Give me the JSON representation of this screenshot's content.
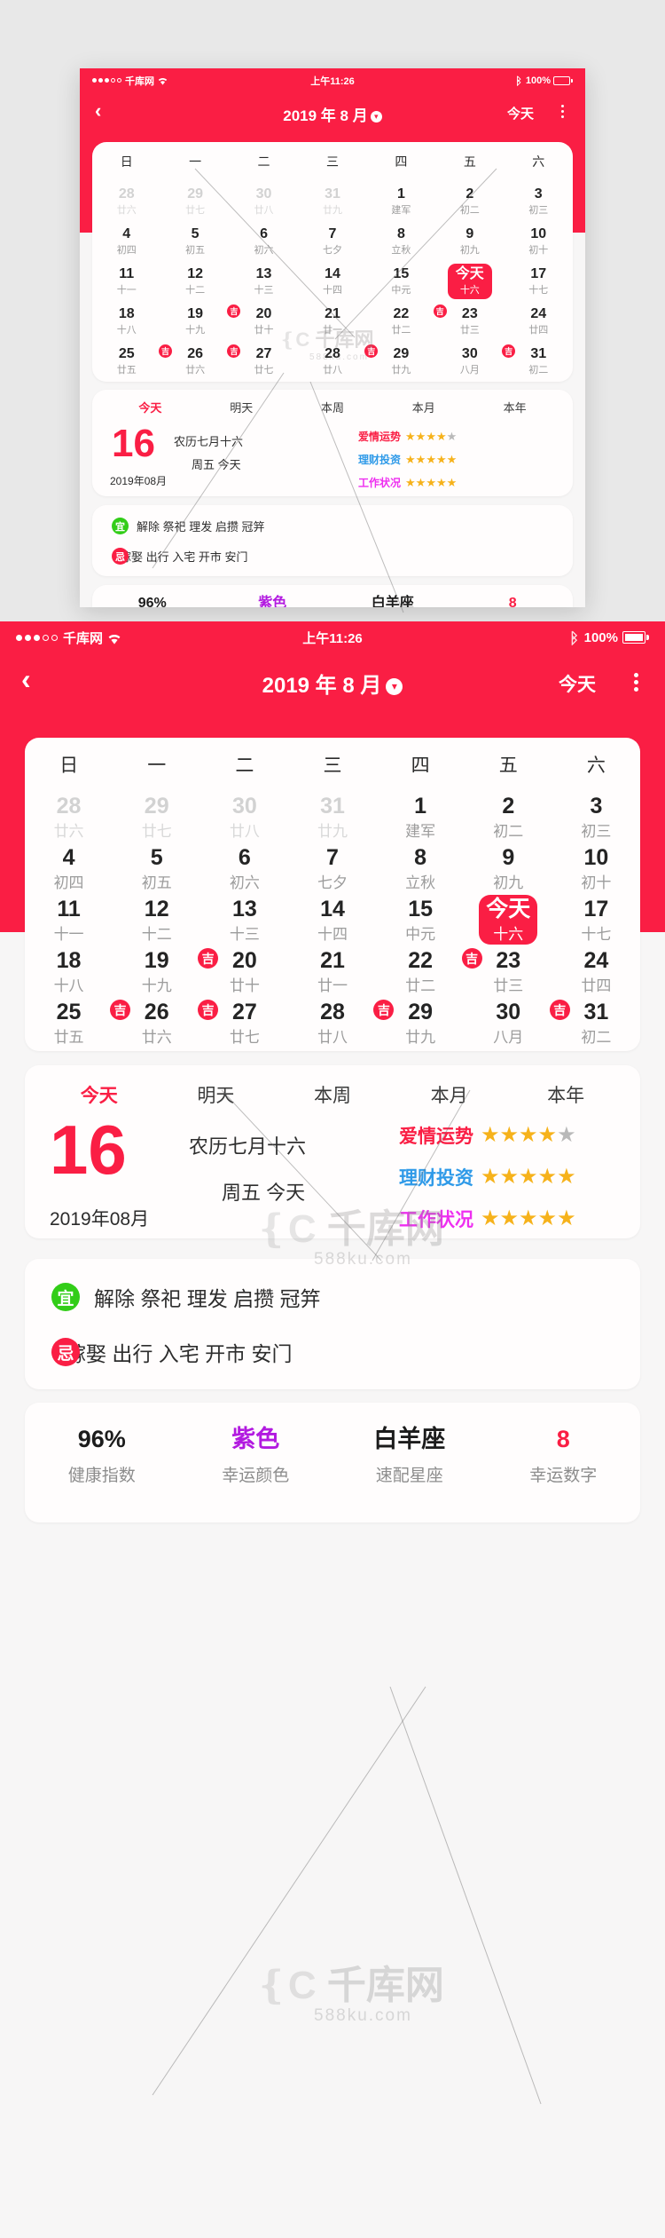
{
  "colors": {
    "brand_red": "#fa1e44",
    "bg_gray": "#e8e8e8",
    "card_white": "#fffdfd",
    "page_gray": "#f7f6f6",
    "star_gold": "#f6b21b",
    "star_off": "#b9b9b9",
    "yi_green": "#32cd18",
    "purple": "#b21ae0",
    "blue": "#2f9ae8",
    "magenta": "#ee2ff0"
  },
  "status_bar": {
    "signal_dots_filled": 3,
    "signal_dots_total": 5,
    "carrier": "千库网",
    "wifi_icon": "wifi-icon",
    "time": "上午11:26",
    "bluetooth_icon": "bluetooth-icon",
    "battery_text": "100%",
    "battery_icon": "battery-full-icon"
  },
  "navbar": {
    "back_icon": "chevron-left-icon",
    "title": "2019 年 8 月",
    "title_chevron_icon": "chevron-down-circle-icon",
    "today_label": "今天",
    "more_icon": "more-vertical-icon"
  },
  "calendar": {
    "weekdays": [
      "日",
      "一",
      "二",
      "三",
      "四",
      "五",
      "六"
    ],
    "rows": [
      [
        {
          "solar": "28",
          "lunar": "廿六",
          "dim": true
        },
        {
          "solar": "29",
          "lunar": "廿七",
          "dim": true
        },
        {
          "solar": "30",
          "lunar": "廿八",
          "dim": true
        },
        {
          "solar": "31",
          "lunar": "廿九",
          "dim": true
        },
        {
          "solar": "1",
          "lunar": "建军"
        },
        {
          "solar": "2",
          "lunar": "初二"
        },
        {
          "solar": "3",
          "lunar": "初三"
        }
      ],
      [
        {
          "solar": "4",
          "lunar": "初四"
        },
        {
          "solar": "5",
          "lunar": "初五"
        },
        {
          "solar": "6",
          "lunar": "初六"
        },
        {
          "solar": "7",
          "lunar": "七夕"
        },
        {
          "solar": "8",
          "lunar": "立秋"
        },
        {
          "solar": "9",
          "lunar": "初九"
        },
        {
          "solar": "10",
          "lunar": "初十"
        }
      ],
      [
        {
          "solar": "11",
          "lunar": "十一"
        },
        {
          "solar": "12",
          "lunar": "十二"
        },
        {
          "solar": "13",
          "lunar": "十三"
        },
        {
          "solar": "14",
          "lunar": "十四"
        },
        {
          "solar": "15",
          "lunar": "中元"
        },
        {
          "solar": "今天",
          "lunar": "十六",
          "today": true
        },
        {
          "solar": "17",
          "lunar": "十七"
        }
      ],
      [
        {
          "solar": "18",
          "lunar": "十八"
        },
        {
          "solar": "19",
          "lunar": "十九",
          "badge": "吉"
        },
        {
          "solar": "20",
          "lunar": "廿十"
        },
        {
          "solar": "21",
          "lunar": "廿一"
        },
        {
          "solar": "22",
          "lunar": "廿二",
          "badge": "吉"
        },
        {
          "solar": "23",
          "lunar": "廿三"
        },
        {
          "solar": "24",
          "lunar": "廿四"
        }
      ],
      [
        {
          "solar": "25",
          "lunar": "廿五",
          "badge": "吉"
        },
        {
          "solar": "26",
          "lunar": "廿六",
          "badge": "吉"
        },
        {
          "solar": "27",
          "lunar": "廿七"
        },
        {
          "solar": "28",
          "lunar": "廿八",
          "badge": "吉"
        },
        {
          "solar": "29",
          "lunar": "廿九"
        },
        {
          "solar": "30",
          "lunar": "八月",
          "badge": "吉"
        },
        {
          "solar": "31",
          "lunar": "初二"
        }
      ]
    ]
  },
  "tabs": [
    {
      "label": "今天",
      "active": true
    },
    {
      "label": "明天",
      "active": false
    },
    {
      "label": "本周",
      "active": false
    },
    {
      "label": "本月",
      "active": false
    },
    {
      "label": "本年",
      "active": false
    }
  ],
  "detail": {
    "day_number": "16",
    "lunar_date": "农历七月十六",
    "weekday_today": "周五  今天",
    "year_month": "2019年08月",
    "fortunes": [
      {
        "label": "爱情运势",
        "color": "#fa1e44",
        "stars": 4,
        "total": 5
      },
      {
        "label": "理财投资",
        "color": "#2f9ae8",
        "stars": 5,
        "total": 5
      },
      {
        "label": "工作状况",
        "color": "#ee2ff0",
        "stars": 5,
        "total": 5
      }
    ]
  },
  "almanac": {
    "yi_badge": "宜",
    "yi_items": "解除  祭祀  理发  启攒  冠笄",
    "ji_badge": "忌",
    "ji_items": "嫁娶  出行  入宅  开市  安门"
  },
  "stats": [
    {
      "value": "96%",
      "label": "健康指数",
      "color": "#1c1c1c"
    },
    {
      "value": "紫色",
      "label": "幸运颜色",
      "color": "#b21ae0"
    },
    {
      "value": "白羊座",
      "label": "速配星座",
      "color": "#1c1c1c"
    },
    {
      "value": "8",
      "label": "幸运数字",
      "color": "#fa1e44"
    }
  ],
  "watermark": {
    "text": "千库网",
    "sub": "588ku.com"
  }
}
